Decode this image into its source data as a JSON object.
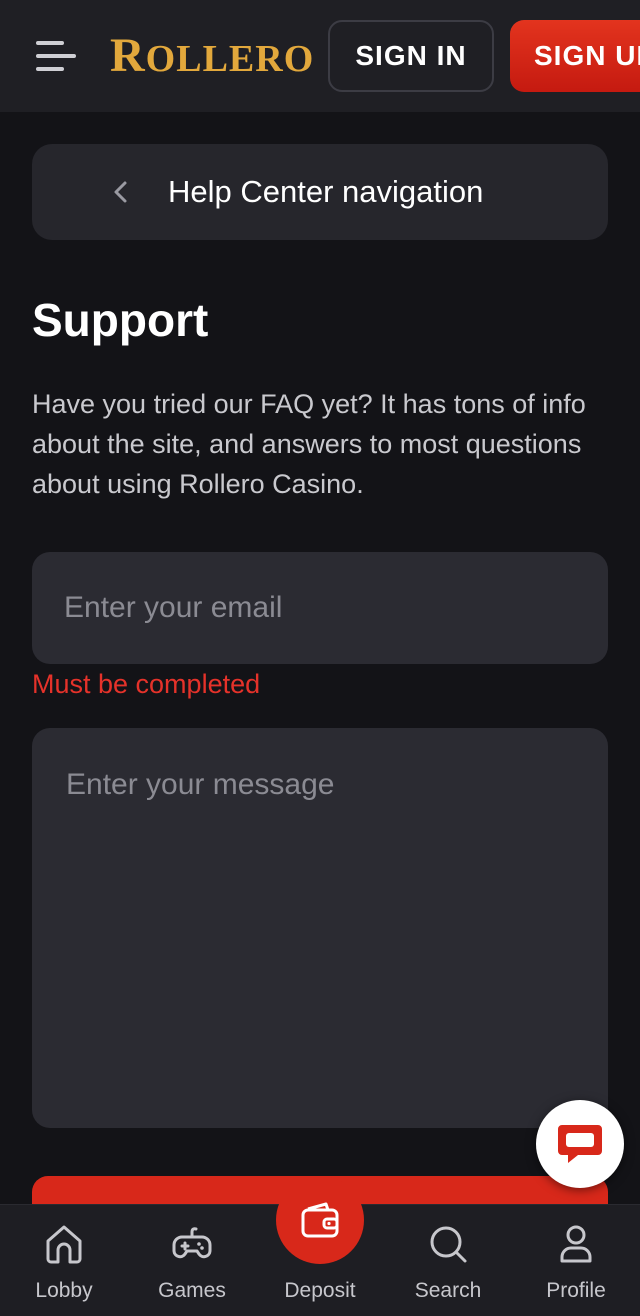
{
  "header": {
    "logo_text": "Rollero",
    "signin_label": "SIGN IN",
    "signup_label": "SIGN UP"
  },
  "help_nav": {
    "label": "Help Center navigation"
  },
  "main": {
    "title": "Support",
    "intro": "Have you tried our FAQ yet? It has tons of info about the site, and answers to most questions about using Rollero Casino.",
    "email_placeholder": "Enter your email",
    "email_error": "Must be completed",
    "message_placeholder": "Enter your message"
  },
  "bottom_nav": {
    "lobby": "Lobby",
    "games": "Games",
    "deposit": "Deposit",
    "search": "Search",
    "profile": "Profile"
  },
  "colors": {
    "background": "#131317",
    "accent_red": "#d8281a",
    "logo_gold": "#e2a83c",
    "error_red": "#e5322a"
  }
}
